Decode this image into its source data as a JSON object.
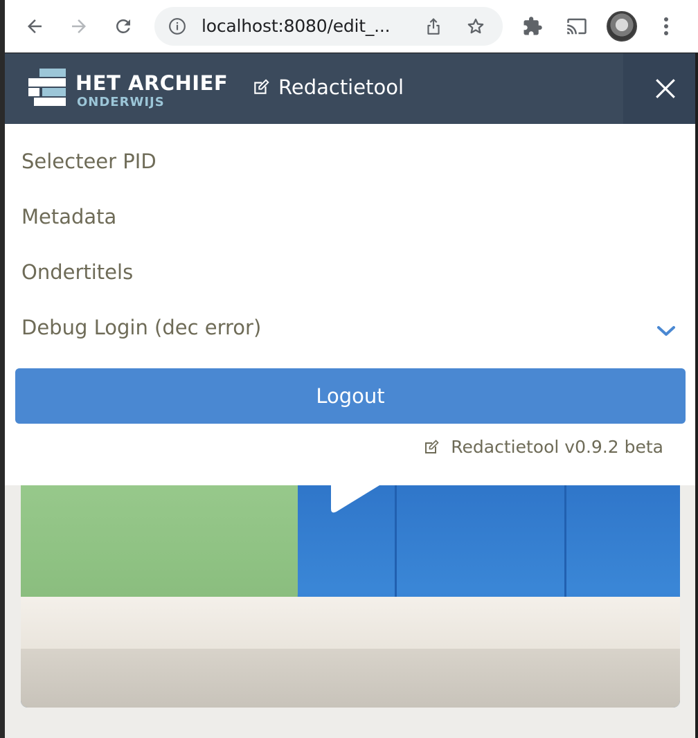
{
  "browser": {
    "url": "localhost:8080/edit_...",
    "icons": [
      "back-arrow-icon",
      "forward-arrow-icon",
      "reload-icon",
      "info-icon",
      "share-icon",
      "star-icon",
      "extensions-icon",
      "cast-icon",
      "profile-avatar",
      "kebab-menu-icon"
    ]
  },
  "navbar": {
    "logo_title": "HET ARCHIEF",
    "logo_subtitle": "ONDERWIJS",
    "tool_label": "Redactietool",
    "colors": {
      "background": "#3b4a5c",
      "logo_accent": "#9cc6d8"
    }
  },
  "menu": {
    "items": [
      {
        "label": "Selecteer PID"
      },
      {
        "label": "Metadata"
      },
      {
        "label": "Ondertitels"
      },
      {
        "label": "Debug Login (dec error)"
      }
    ],
    "logout_label": "Logout",
    "version_label": "Redactietool v0.9.2 beta",
    "colors": {
      "text": "#6e6b57",
      "logout_bg": "#4a88d2",
      "chevron": "#4a88d2"
    }
  },
  "video": {
    "play_icon": "play-icon"
  }
}
